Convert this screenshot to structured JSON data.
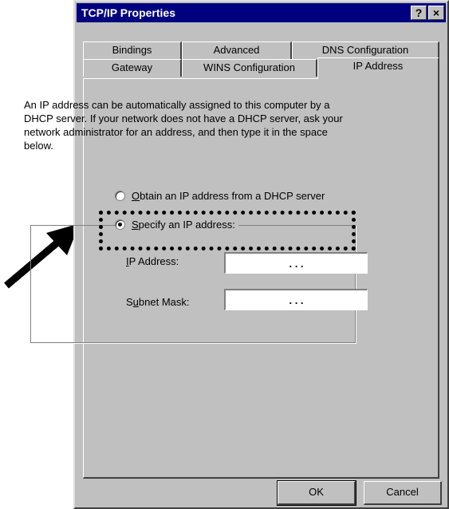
{
  "window": {
    "title": "TCP/IP Properties",
    "help_label": "?",
    "close_label": "×"
  },
  "tabs": {
    "row1": [
      "Bindings",
      "Advanced",
      "DNS Configuration"
    ],
    "row2": [
      "Gateway",
      "WINS Configuration",
      "IP Address"
    ],
    "active": "IP Address"
  },
  "description": "An IP address can be automatically assigned to this computer by a DHCP server. If your network does not have a DHCP server, ask your network administrator for an address, and then type it in the space below.",
  "options": {
    "obtain": {
      "accel": "O",
      "rest": "btain an IP address from a DHCP server",
      "selected": false
    },
    "specify": {
      "accel": "S",
      "rest": "pecify an IP address:",
      "selected": true
    }
  },
  "fields": {
    "ip_address": {
      "label_accel": "I",
      "label_rest": "P Address:",
      "value": ". . ."
    },
    "subnet_mask": {
      "label_pre": "S",
      "label_accel": "u",
      "label_rest": "bnet Mask:",
      "value": ". . ."
    }
  },
  "buttons": {
    "ok": "OK",
    "cancel": "Cancel"
  },
  "annotations": {
    "arrow": "arrow-icon",
    "highlight": "dotted-highlight"
  }
}
